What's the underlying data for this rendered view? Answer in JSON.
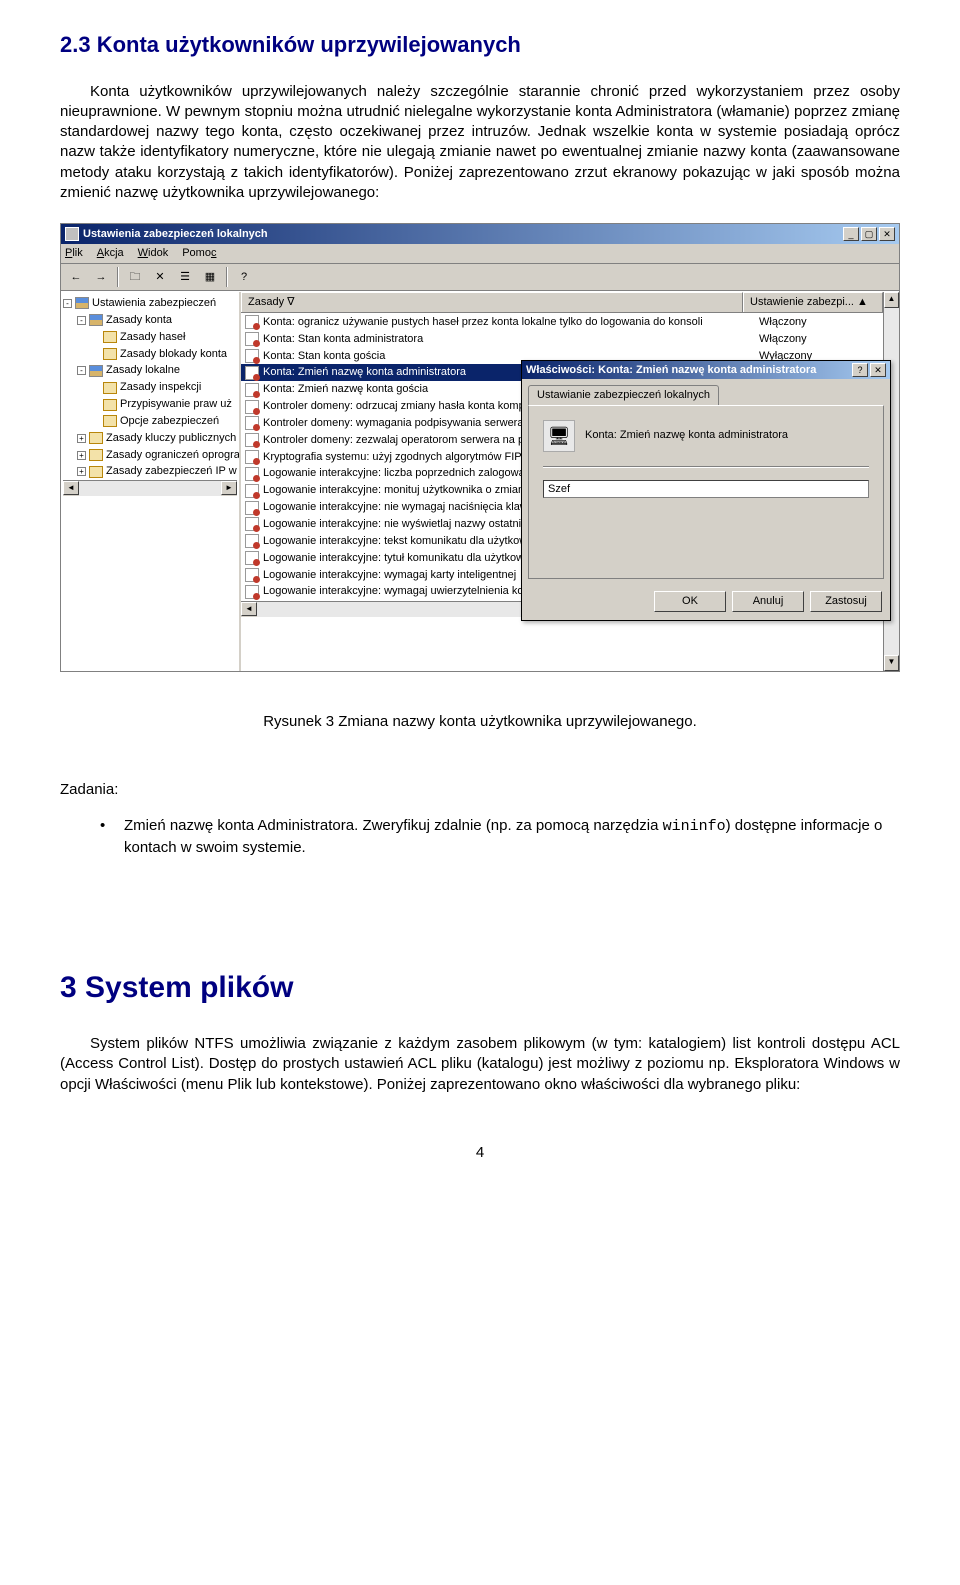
{
  "doc": {
    "heading23": "2.3 Konta użytkowników uprzywilejowanych",
    "para1": "Konta użytkowników uprzywilejowanych należy szczególnie starannie chronić przed wykorzystaniem przez osoby nieuprawnione. W pewnym stopniu można utrudnić nielegalne wykorzystanie konta Administratora (włamanie) poprzez zmianę standardowej nazwy tego konta, często oczekiwanej przez intruzów. Jednak wszelkie konta w systemie posiadają oprócz nazw także identyfikatory numeryczne, które nie ulegają zmianie nawet po ewentualnej zmianie nazwy konta (zaawansowane metody ataku korzystają z takich identyfikatorów). Poniżej zaprezentowano zrzut ekranowy pokazując w jaki sposób można zmienić nazwę użytkownika uprzywilejowanego:",
    "figcaption": "Rysunek 3 Zmiana nazwy konta użytkownika uprzywilejowanego.",
    "tasks_label": "Zadania:",
    "task1_a": "Zmień nazwę konta Administratora. Zweryfikuj zdalnie (np. za pomocą narzędzia ",
    "task1_code": "wininfo",
    "task1_b": ") dostępne informacje o kontach w swoim systemie.",
    "heading3": "3  System plików",
    "para3": "System plików NTFS umożliwia związanie z każdym zasobem plikowym (w tym: katalogiem) list kontroli dostępu ACL (Access Control List). Dostęp do prostych ustawień ACL pliku (katalogu) jest możliwy z poziomu np. Eksploratora Windows w opcji Właściwości (menu Plik lub kontekstowe). Poniżej zaprezentowano okno właściwości dla wybranego pliku:",
    "page_number": "4"
  },
  "app": {
    "title": "Ustawienia zabezpieczeń lokalnych",
    "menu": {
      "plik": "Plik",
      "akcja": "Akcja",
      "widok": "Widok",
      "pomoc": "Pomoc"
    },
    "toolbar_icons": {
      "back": "←",
      "fwd": "→",
      "up": "▲",
      "cut": "✂",
      "props": "☰",
      "props2": "▦",
      "help": "?"
    },
    "tree": [
      {
        "level": 0,
        "toggle": "-",
        "icon": "book",
        "label": "Ustawienia zabezpieczeń"
      },
      {
        "level": 1,
        "toggle": "-",
        "icon": "book",
        "label": "Zasady konta"
      },
      {
        "level": 2,
        "toggle": "",
        "icon": "folder",
        "label": "Zasady haseł"
      },
      {
        "level": 2,
        "toggle": "",
        "icon": "folder",
        "label": "Zasady blokady konta"
      },
      {
        "level": 1,
        "toggle": "-",
        "icon": "book",
        "label": "Zasady lokalne"
      },
      {
        "level": 2,
        "toggle": "",
        "icon": "folder",
        "label": "Zasady inspekcji"
      },
      {
        "level": 2,
        "toggle": "",
        "icon": "folder",
        "label": "Przypisywanie praw uż"
      },
      {
        "level": 2,
        "toggle": "",
        "icon": "folder-open",
        "label": "Opcje zabezpieczeń"
      },
      {
        "level": 1,
        "toggle": "+",
        "icon": "folder",
        "label": "Zasady kluczy publicznych"
      },
      {
        "level": 1,
        "toggle": "+",
        "icon": "folder",
        "label": "Zasady ograniczeń oprogra"
      },
      {
        "level": 1,
        "toggle": "+",
        "icon": "folder",
        "label": "Zasady zabezpieczeń IP w"
      }
    ],
    "columns": {
      "name": "Zasady  ∇",
      "value": "Ustawienie zabezpi...  ▲"
    },
    "policies": [
      {
        "name": "Konta: ogranicz używanie pustych haseł przez konta lokalne tylko do logowania do konsoli",
        "value": "Włączony"
      },
      {
        "name": "Konta: Stan konta administratora",
        "value": "Włączony"
      },
      {
        "name": "Konta: Stan konta gościa",
        "value": "Wyłączony"
      },
      {
        "name": "Konta: Zmień nazwę konta administratora",
        "value": "",
        "selected": true
      },
      {
        "name": "Konta: Zmień nazwę konta gościa",
        "value": ""
      },
      {
        "name": "Kontroler domeny: odrzucaj zmiany hasła konta kompu",
        "value": ""
      },
      {
        "name": "Kontroler domeny: wymagania podpisywania serwera",
        "value": ""
      },
      {
        "name": "Kontroler domeny: zezwalaj operatorom serwera na p",
        "value": ""
      },
      {
        "name": "Kryptografia systemu: użyj zgodnych algorytmów FIP",
        "value": ""
      },
      {
        "name": "Logowanie interakcyjne: liczba poprzednich zalogowan",
        "value": ""
      },
      {
        "name": "Logowanie interakcyjne: monituj użytkownika o zmian",
        "value": ""
      },
      {
        "name": "Logowanie interakcyjne: nie wymagaj naciśnięcia klaw",
        "value": ""
      },
      {
        "name": "Logowanie interakcyjne: nie wyświetlaj nazwy ostatni",
        "value": ""
      },
      {
        "name": "Logowanie interakcyjne: tekst komunikatu dla użytkow",
        "value": ""
      },
      {
        "name": "Logowanie interakcyjne: tytuł komunikatu dla użytkow",
        "value": ""
      },
      {
        "name": "Logowanie interakcyjne: wymagaj karty inteligentnej",
        "value": ""
      },
      {
        "name": "Logowanie interakcyjne: wymagaj uwierzytelnienia ko",
        "value": ""
      }
    ],
    "dialog": {
      "title": "Właściwości: Konta: Zmień nazwę konta administratora",
      "tab": "Ustawianie zabezpieczeń lokalnych",
      "desc": "Konta: Zmień nazwę konta administratora",
      "input_value": "Szef",
      "ok": "OK",
      "cancel": "Anuluj",
      "apply": "Zastosuj"
    }
  }
}
